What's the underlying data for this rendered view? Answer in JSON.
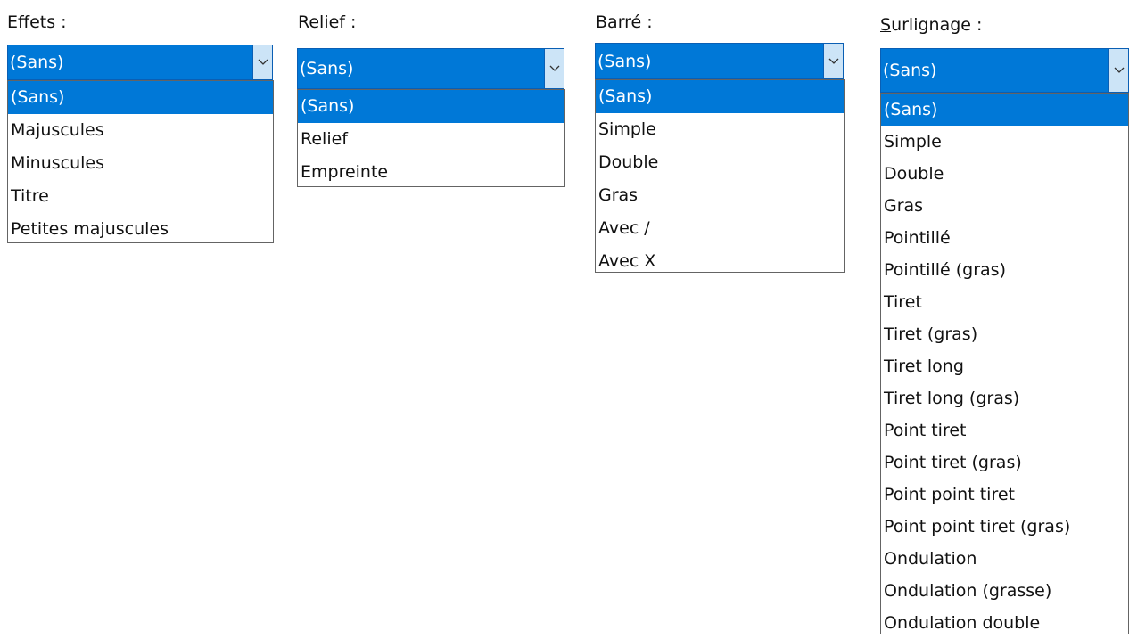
{
  "accent_color": "#0078d7",
  "dropdowns": [
    {
      "label_accel": "E",
      "label_rest": "ffets :",
      "selected": "(Sans)",
      "options": [
        "(Sans)",
        "Majuscules",
        "Minuscules",
        "Titre",
        "Petites majuscules"
      ]
    },
    {
      "label_accel": "R",
      "label_rest": "elief :",
      "selected": "(Sans)",
      "options": [
        "(Sans)",
        "Relief",
        "Empreinte"
      ]
    },
    {
      "label_accel": "B",
      "label_rest": "arré :",
      "selected": "(Sans)",
      "options": [
        "(Sans)",
        "Simple",
        "Double",
        "Gras",
        "Avec /",
        "Avec X"
      ]
    },
    {
      "label_accel": "S",
      "label_rest": "urlignage :",
      "selected": "(Sans)",
      "options": [
        "(Sans)",
        "Simple",
        "Double",
        "Gras",
        "Pointillé",
        "Pointillé (gras)",
        "Tiret",
        "Tiret (gras)",
        "Tiret long",
        "Tiret long (gras)",
        "Point tiret",
        "Point tiret (gras)",
        "Point point tiret",
        "Point point tiret (gras)",
        "Ondulation",
        "Ondulation (grasse)",
        "Ondulation double"
      ]
    }
  ]
}
